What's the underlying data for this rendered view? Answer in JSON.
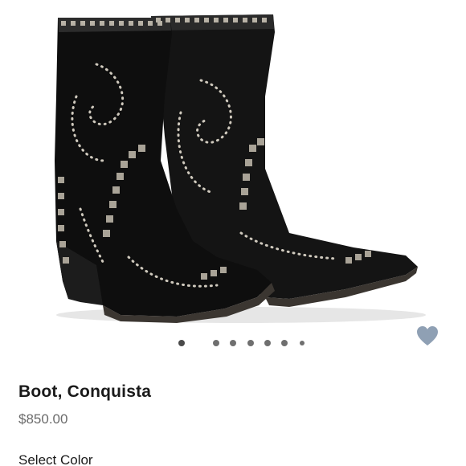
{
  "product": {
    "title": "Boot, Conquista",
    "price": "$850.00",
    "image_alt": "Black studded western boots"
  },
  "carousel": {
    "image_count": 8,
    "active_index": 0
  },
  "actions": {
    "like_icon": "heart-icon",
    "like_color": "#8fa0b4"
  },
  "options": {
    "select_color_label": "Select Color"
  }
}
